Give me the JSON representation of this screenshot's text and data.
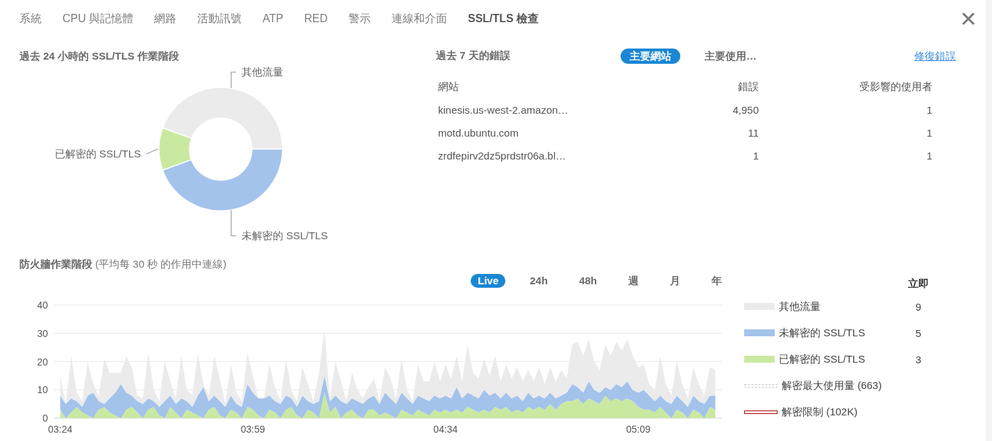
{
  "tabs": [
    {
      "label": "系統",
      "selected": false
    },
    {
      "label": "CPU 與記憶體",
      "selected": false
    },
    {
      "label": "網路",
      "selected": false
    },
    {
      "label": "活動訊號",
      "selected": false
    },
    {
      "label": "ATP",
      "selected": false
    },
    {
      "label": "RED",
      "selected": false
    },
    {
      "label": "警示",
      "selected": false
    },
    {
      "label": "連線和介面",
      "selected": false
    },
    {
      "label": "SSL/TLS 檢查",
      "selected": true
    }
  ],
  "sessions_24h": {
    "title": "過去 24 小時的 SSL/TLS 作業階段",
    "slices": [
      {
        "label": "其他流量",
        "color": "#ebebeb"
      },
      {
        "label": "已解密的 SSL/TLS",
        "color": "#c9e9a1"
      },
      {
        "label": "未解密的 SSL/TLS",
        "color": "#a3c3eb"
      }
    ]
  },
  "errors_7d": {
    "title": "過去 7 天的錯誤",
    "views": [
      {
        "label": "主要網站",
        "selected": true
      },
      {
        "label": "主要使用…",
        "selected": false
      }
    ],
    "link": "修復錯誤",
    "columns": [
      "網站",
      "錯誤",
      "受影響的使用者"
    ],
    "rows": [
      [
        "kinesis.us-west-2.amazon…",
        "4,950",
        "1"
      ],
      [
        "motd.ubuntu.com",
        "11",
        "1"
      ],
      [
        "zrdfepirv2dz5prdstr06a.bl…",
        "1",
        "1"
      ]
    ]
  },
  "firewall": {
    "title": "**防火牆作業階段** (平均每 30 秒 的作用中連線)",
    "ranges": [
      {
        "label": "Live",
        "selected": true
      },
      {
        "label": "24h",
        "selected": false
      },
      {
        "label": "48h",
        "selected": false
      },
      {
        "label": "週",
        "selected": false
      },
      {
        "label": "月",
        "selected": false
      },
      {
        "label": "年",
        "selected": false
      }
    ],
    "chart_data": {
      "type": "area",
      "stacked": true,
      "grid": true,
      "categories": [
        "03:24",
        null,
        null,
        null,
        null,
        null,
        null,
        null,
        null,
        null,
        null,
        null,
        null,
        null,
        null,
        null,
        null,
        null,
        null,
        null,
        null,
        null,
        null,
        null,
        null,
        null,
        null,
        null,
        null,
        null,
        null,
        null,
        null,
        null,
        null,
        "03:59",
        null,
        null,
        null,
        null,
        null,
        null,
        null,
        null,
        null,
        null,
        null,
        null,
        null,
        null,
        null,
        null,
        null,
        null,
        null,
        null,
        null,
        null,
        null,
        null,
        null,
        null,
        null,
        null,
        null,
        null,
        null,
        null,
        null,
        null,
        "04:34",
        null,
        null,
        null,
        null,
        null,
        null,
        null,
        null,
        null,
        null,
        null,
        null,
        null,
        null,
        null,
        null,
        null,
        null,
        null,
        null,
        null,
        null,
        null,
        null,
        null,
        null,
        null,
        null,
        null,
        null,
        null,
        null,
        null,
        null,
        "05:09",
        null,
        null,
        null,
        null,
        null,
        null,
        null,
        null,
        null,
        null,
        null,
        null,
        null,
        null
      ],
      "ylim": [
        0,
        40
      ],
      "yticks": [
        0,
        10,
        20,
        30,
        40
      ],
      "series": [
        {
          "name": "已解密的 SSL/TLS",
          "color": "#c9e9a1",
          "values": [
            3,
            0,
            2,
            4,
            2,
            1,
            0,
            3,
            4,
            2,
            1,
            0,
            3,
            4,
            2,
            0,
            3,
            4,
            1,
            0,
            4,
            2,
            0,
            3,
            2,
            1,
            0,
            3,
            4,
            1,
            0,
            3,
            2,
            0,
            4,
            3,
            1,
            0,
            3,
            2,
            0,
            3,
            4,
            1,
            0,
            3,
            2,
            0,
            9,
            2,
            4,
            0,
            2,
            3,
            1,
            0,
            3,
            3,
            1,
            2,
            1,
            0,
            3,
            2,
            1,
            3,
            2,
            1,
            3,
            2,
            3,
            2,
            3,
            2,
            4,
            3,
            2,
            3,
            2,
            4,
            3,
            4,
            2,
            3,
            2,
            4,
            3,
            4,
            3,
            5,
            3,
            5,
            6,
            6,
            7,
            5,
            7,
            6,
            5,
            8,
            6,
            7,
            6,
            7,
            6,
            4,
            3,
            3,
            2,
            4,
            2,
            0,
            3,
            2,
            0,
            3,
            2,
            0,
            4,
            3
          ]
        },
        {
          "name": "未解密的 SSL/TLS",
          "color": "#a3c3eb",
          "values": [
            5,
            5,
            5,
            2,
            2,
            7,
            9,
            3,
            1,
            5,
            8,
            12,
            6,
            4,
            4,
            5,
            4,
            2,
            3,
            6,
            4,
            3,
            7,
            3,
            2,
            7,
            11,
            3,
            4,
            5,
            4,
            5,
            3,
            4,
            8,
            6,
            6,
            7,
            5,
            4,
            5,
            5,
            3,
            3,
            8,
            3,
            3,
            6,
            6,
            4,
            4,
            6,
            3,
            4,
            5,
            5,
            4,
            5,
            4,
            7,
            6,
            5,
            6,
            5,
            4,
            5,
            5,
            5,
            5,
            5,
            5,
            5,
            8,
            5,
            5,
            5,
            5,
            7,
            6,
            5,
            4,
            5,
            5,
            5,
            4,
            5,
            4,
            4,
            4,
            4,
            4,
            3,
            3,
            6,
            4,
            4,
            6,
            4,
            4,
            3,
            4,
            5,
            5,
            6,
            4,
            5,
            7,
            5,
            4,
            4,
            4,
            5,
            5,
            4,
            4,
            5,
            4,
            5,
            4,
            5
          ]
        },
        {
          "name": "其他流量",
          "color": "#ebebeb",
          "values": [
            7,
            0,
            15,
            3,
            2,
            12,
            3,
            2,
            16,
            9,
            7,
            4,
            13,
            10,
            2,
            2,
            16,
            4,
            2,
            14,
            5,
            2,
            15,
            4,
            4,
            15,
            1,
            2,
            14,
            8,
            1,
            11,
            4,
            2,
            11,
            6,
            0,
            0,
            11,
            5,
            1,
            13,
            3,
            2,
            10,
            6,
            1,
            10,
            16,
            1,
            12,
            7,
            1,
            9,
            4,
            2,
            4,
            6,
            1,
            9,
            7,
            2,
            12,
            3,
            1,
            11,
            6,
            7,
            12,
            6,
            11,
            7,
            11,
            6,
            17,
            8,
            7,
            11,
            7,
            13,
            6,
            10,
            7,
            10,
            7,
            8,
            6,
            10,
            5,
            9,
            6,
            9,
            5,
            14,
            16,
            13,
            15,
            10,
            8,
            15,
            12,
            15,
            13,
            15,
            12,
            9,
            9,
            4,
            4,
            14,
            6,
            3,
            12,
            6,
            3,
            10,
            6,
            3,
            10,
            9
          ]
        }
      ]
    },
    "legend": {
      "heading": "立即",
      "readings": [
        "9",
        "5",
        "3"
      ],
      "lines": [
        {
          "kind": "dashed",
          "label": "解密最大使用量 (663)"
        },
        {
          "kind": "double",
          "label": "解密限制 (102K)"
        }
      ]
    }
  }
}
